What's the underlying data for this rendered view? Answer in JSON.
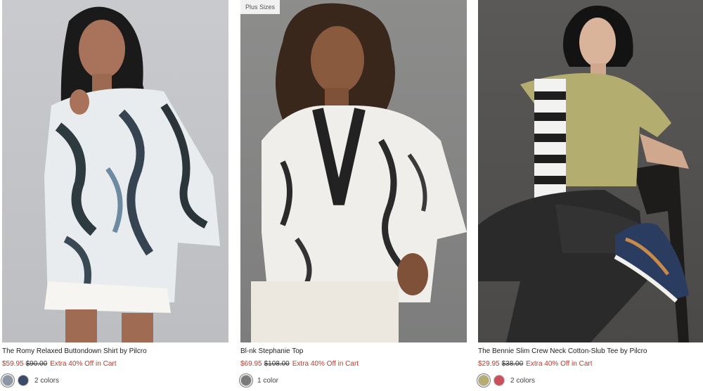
{
  "products": [
    {
      "title": "The Romy Relaxed Buttondown Shirt by Pilcro",
      "sale_price": "$59.95",
      "original_price": "$90.00",
      "promo": "Extra 40% Off in Cart",
      "colors_label": "2 colors",
      "swatches": [
        "#8c97a3",
        "#3b4a6b"
      ]
    },
    {
      "badge": "Plus Sizes",
      "title": "Bl-nk Stephanie Top",
      "sale_price": "$69.95",
      "original_price": "$108.00",
      "promo": "Extra 40% Off in Cart",
      "colors_label": "1 color",
      "swatches": [
        "#7a7a7a"
      ]
    },
    {
      "title": "The Bennie Slim Crew Neck Cotton-Slub Tee by Pilcro",
      "sale_price": "$29.95",
      "original_price": "$38.00",
      "promo": "Extra 40% Off in Cart",
      "colors_label": "2 colors",
      "swatches": [
        "#b4ad6e",
        "#c9505c"
      ]
    }
  ],
  "colors": {
    "sale": "#c0392b",
    "text": "#222222"
  }
}
